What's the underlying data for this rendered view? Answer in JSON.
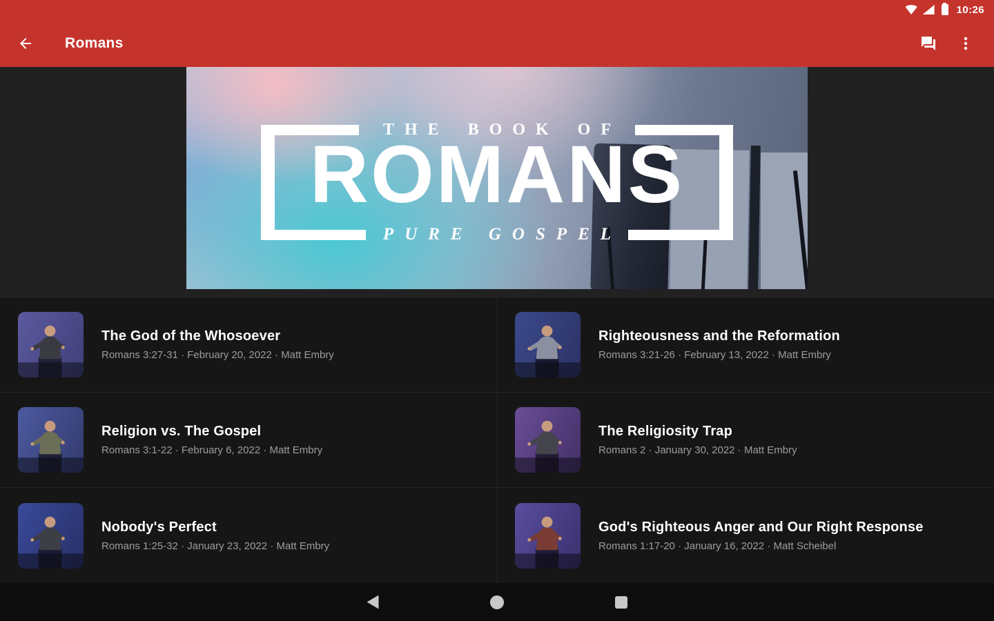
{
  "status_bar": {
    "time": "10:26",
    "icons": [
      "wifi-icon",
      "signal-icon",
      "battery-icon"
    ]
  },
  "app_bar": {
    "title": "Romans",
    "back_icon": "back-arrow-icon",
    "actions": [
      "forum-icon",
      "overflow-menu-icon"
    ]
  },
  "banner": {
    "kicker": "THE BOOK OF",
    "title": "ROMANS",
    "subtitle": "PURE GOSPEL"
  },
  "sermons": [
    {
      "title": "The God of the Whosoever",
      "meta": "Romans 3:27-31 · February 20, 2022 · Matt Embry",
      "thumb": {
        "bg1": "#5c5a9e",
        "bg2": "#3f3f7a",
        "shirt": "#3a3a42"
      }
    },
    {
      "title": "Righteousness and the Reformation",
      "meta": "Romans 3:21-26 · February 13, 2022 · Matt Embry",
      "thumb": {
        "bg1": "#3c4a8c",
        "bg2": "#2b3264",
        "shirt": "#8b8fa0"
      }
    },
    {
      "title": "Religion vs. The Gospel",
      "meta": "Romans 3:1-22 · February 6, 2022 · Matt Embry",
      "thumb": {
        "bg1": "#4d5aa0",
        "bg2": "#333a6e",
        "shirt": "#6b6f58"
      }
    },
    {
      "title": "The Religiosity Trap",
      "meta": "Romans 2 · January 30, 2022 · Matt Embry",
      "thumb": {
        "bg1": "#6a4d96",
        "bg2": "#433068",
        "shirt": "#44444c"
      }
    },
    {
      "title": "Nobody's Perfect",
      "meta": "Romans 1:25-32 · January 23, 2022 · Matt Embry",
      "thumb": {
        "bg1": "#3a4a9a",
        "bg2": "#283068",
        "shirt": "#3e3e46"
      }
    },
    {
      "title": "God's Righteous Anger and Our Right Response",
      "meta": "Romans 1:17-20 · January 16, 2022 · Matt Scheibel",
      "thumb": {
        "bg1": "#5a4d9e",
        "bg2": "#39316e",
        "shirt": "#7a3c34"
      }
    }
  ],
  "nav_bar": {
    "icons": [
      "back-triangle-icon",
      "home-circle-icon",
      "recents-square-icon"
    ]
  },
  "colors": {
    "primary": "#c5342c",
    "hero_background": "#212121",
    "list_background": "#161616",
    "title_text": "#ffffff",
    "meta_text": "#9d9d9d"
  }
}
